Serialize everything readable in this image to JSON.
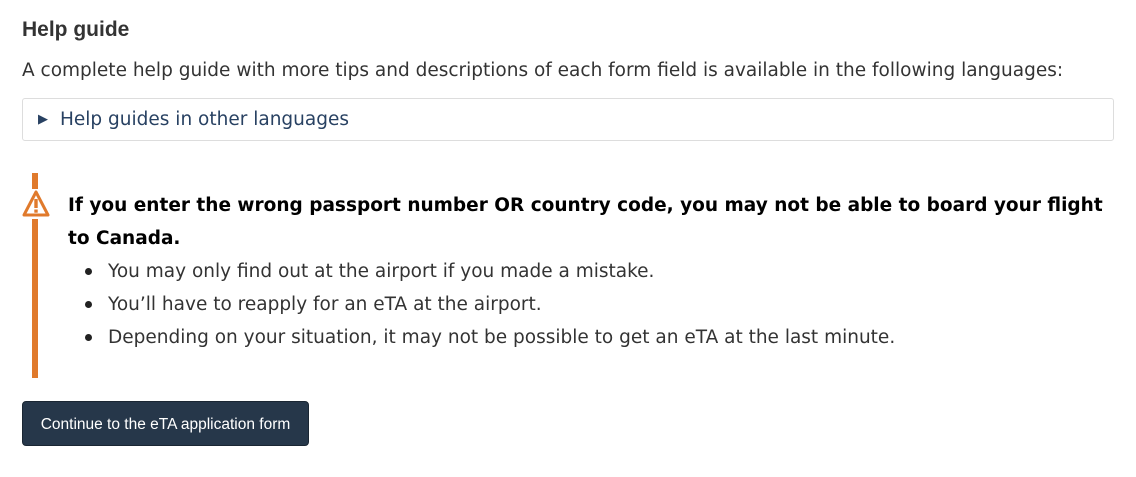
{
  "help": {
    "title": "Help guide",
    "description": "A complete help guide with more tips and descriptions of each form field is available in the following languages:",
    "details_arrow": "▶",
    "details_label": "Help guides in other languages"
  },
  "warning": {
    "icon": "warning-triangle-icon",
    "heading": "If you enter the wrong passport number OR country code, you may not be able to board your flight to Canada.",
    "items": [
      "You may only find out at the airport if you made a mistake.",
      "You’ll have to reapply for an eTA at the airport.",
      "Depending on your situation, it may not be possible to get an eTA at the last minute."
    ]
  },
  "actions": {
    "continue_label": "Continue to the eTA application form"
  },
  "colors": {
    "warning_accent": "#e07a2c",
    "link": "#284162",
    "button_bg": "#26374a"
  }
}
